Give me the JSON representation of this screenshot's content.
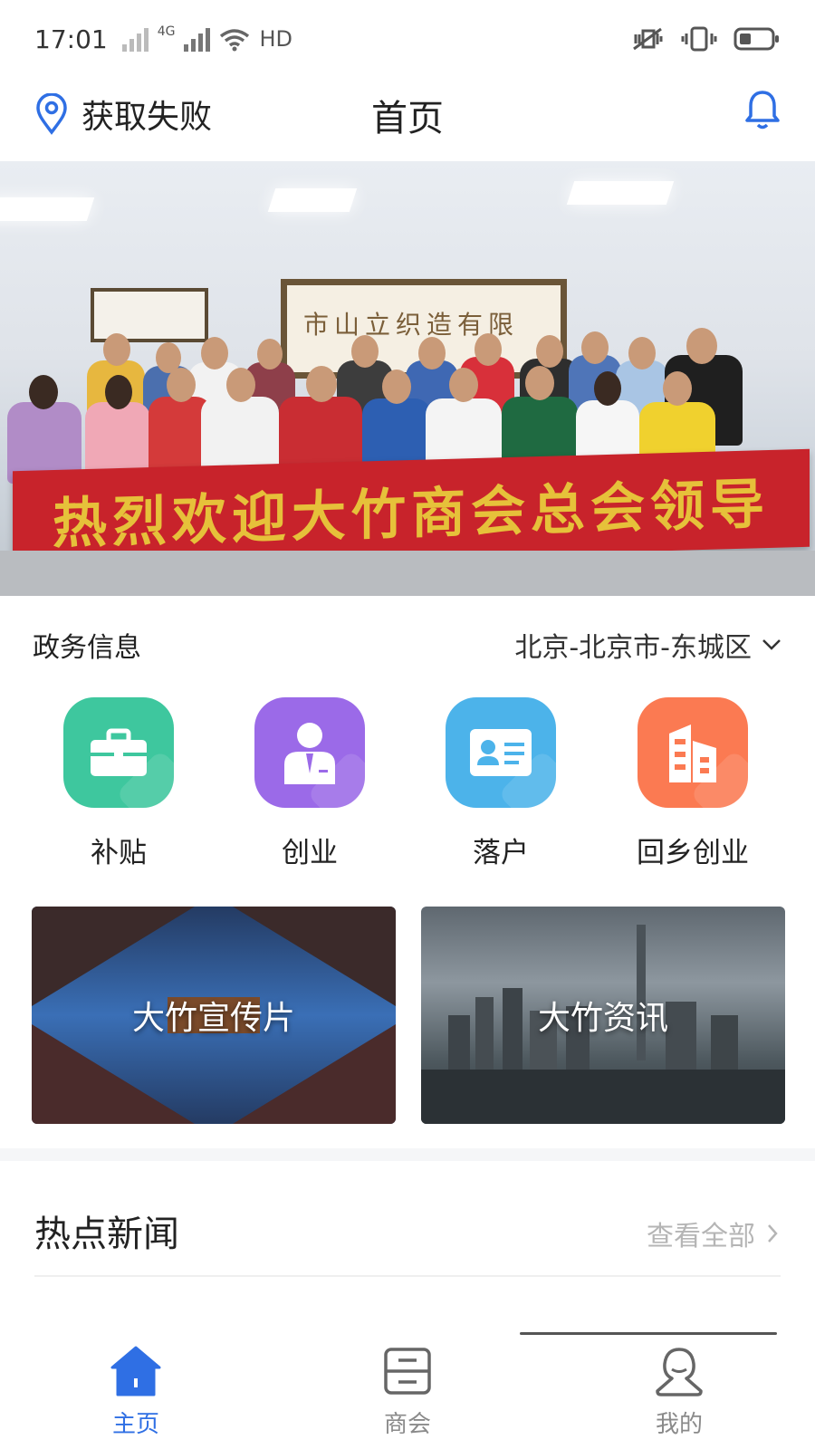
{
  "status_bar": {
    "time": "17:01",
    "network": "4G",
    "hd": "HD",
    "icons": [
      "signal-icon",
      "wifi-icon",
      "vibrate-off-icon",
      "vibrate-icon",
      "battery-icon"
    ]
  },
  "header": {
    "location_text": "获取失败",
    "title": "首页",
    "icons": [
      "location-pin-icon",
      "bell-icon"
    ]
  },
  "banner": {
    "sign_text": "市山立织造有限",
    "welcome_text": "热烈欢迎大竹商会总会领导"
  },
  "gov_info": {
    "title": "政务信息",
    "region": "北京-北京市-东城区"
  },
  "services": [
    {
      "label": "补贴",
      "icon": "briefcase-icon",
      "color": "#3ec79e"
    },
    {
      "label": "创业",
      "icon": "businessman-icon",
      "color": "#9b6ae8"
    },
    {
      "label": "落户",
      "icon": "id-card-icon",
      "color": "#4cb3ea"
    },
    {
      "label": "回乡创业",
      "icon": "building-icon",
      "color": "#fb7a52"
    }
  ],
  "cards": [
    {
      "label": "大竹宣传片"
    },
    {
      "label": "大竹资讯"
    }
  ],
  "news": {
    "title": "热点新闻",
    "view_all": "查看全部"
  },
  "bottom_nav": [
    {
      "label": "主页",
      "icon": "home-icon",
      "active": true
    },
    {
      "label": "商会",
      "icon": "archive-icon",
      "active": false
    },
    {
      "label": "我的",
      "icon": "user-icon",
      "active": false
    }
  ],
  "colors": {
    "accent": "#2f6fe4",
    "banner_red": "#c8232b",
    "banner_gold": "#e6c13a",
    "muted": "#b5b5b5"
  }
}
